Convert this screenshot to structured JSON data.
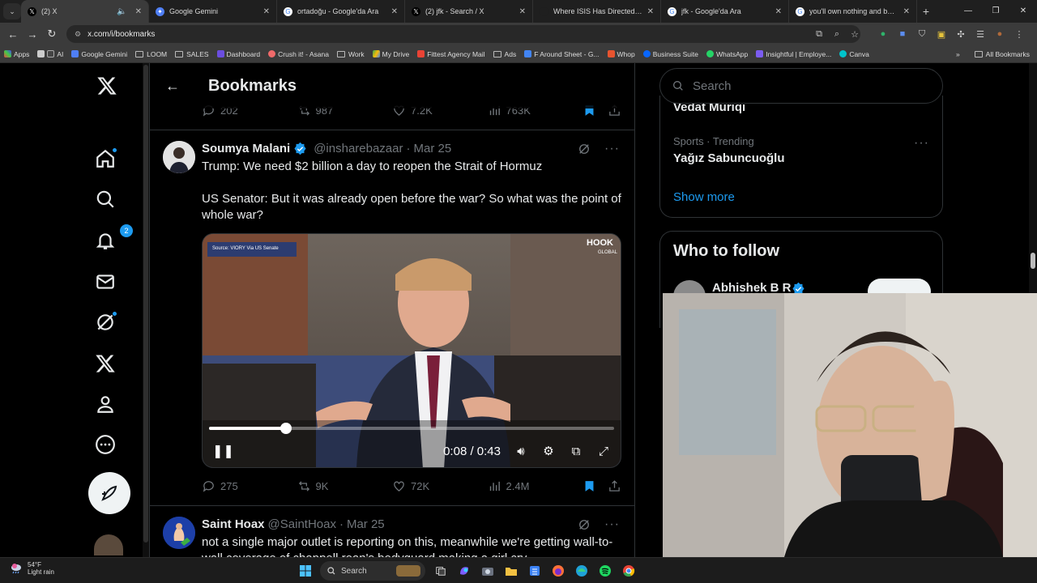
{
  "browser": {
    "tabs": [
      {
        "title": "(2) X",
        "active": true,
        "icon": "x-logo-icon"
      },
      {
        "title": "Google Gemini",
        "active": false,
        "icon": "gemini-icon"
      },
      {
        "title": "ortadoğu - Google'da Ara",
        "active": false,
        "icon": "google-icon"
      },
      {
        "title": "(2) jfk - Search / X",
        "active": false,
        "icon": "x-logo-icon"
      },
      {
        "title": "Where ISIS Has Directed and In",
        "active": false,
        "icon": "news-icon"
      },
      {
        "title": "jfk - Google'da Ara",
        "active": false,
        "icon": "google-icon"
      },
      {
        "title": "you'll own nothing and be hap",
        "active": false,
        "icon": "google-icon"
      }
    ],
    "url": "x.com/i/bookmarks",
    "bookmarks": [
      "Apps",
      "AI",
      "Google Gemini",
      "LOOM",
      "SALES",
      "Dashboard",
      "Crush it! - Asana",
      "Work",
      "My Drive",
      "Fittest Agency Mail",
      "Ads",
      "F Around Sheet - G...",
      "Whop",
      "Business Suite",
      "WhatsApp",
      "Insightful | Employe...",
      "Canva"
    ],
    "all_bookmarks": "All Bookmarks",
    "overflow": "»"
  },
  "nav": {
    "notifications_badge": "2"
  },
  "header": {
    "title": "Bookmarks",
    "back": "←"
  },
  "prev_tweet_actions": {
    "replies": "202",
    "reposts": "987",
    "likes": "7.2K",
    "views": "763K"
  },
  "tweet1": {
    "name": "Soumya Malani",
    "handle": "@insharebazaar",
    "sep": "·",
    "date": "Mar 25",
    "line1": "Trump: We need $2 billion a day to reopen the Strait of Hormuz",
    "line2": "US Senator: But it was already open before the war? So what was the point of whole war?",
    "video": {
      "time": "0:08 / 0:43",
      "progress": 0.19,
      "source_text": "Source: VIORY Via US Senate",
      "overlay_brand": "HOOK",
      "overlay_sub": "GLOBAL"
    },
    "actions": {
      "replies": "275",
      "reposts": "9K",
      "likes": "72K",
      "views": "2.4M"
    }
  },
  "tweet2": {
    "name": "Saint Hoax",
    "handle": "@SaintHoax",
    "sep": "·",
    "date": "Mar 25",
    "text": "not a single major outlet is reporting on this, meanwhile we're getting wall-to-wall coverage of chappell roan's bodyguard making a girl cry"
  },
  "sidebar": {
    "search_placeholder": "Search",
    "trend_partial": "Vedat Muriqi",
    "trend_meta": "Sports · Trending",
    "trend_name": "Yağız Sabuncuoğlu",
    "show_more": "Show more",
    "who_to_follow": "Who to follow",
    "suggest_name": "Abhishek B R"
  },
  "taskbar": {
    "temp": "54°F",
    "condition": "Light rain",
    "search": "Search"
  },
  "colors": {
    "accent": "#1d9bf0",
    "bg": "#000000",
    "border": "#2f3336",
    "muted": "#71767b"
  }
}
